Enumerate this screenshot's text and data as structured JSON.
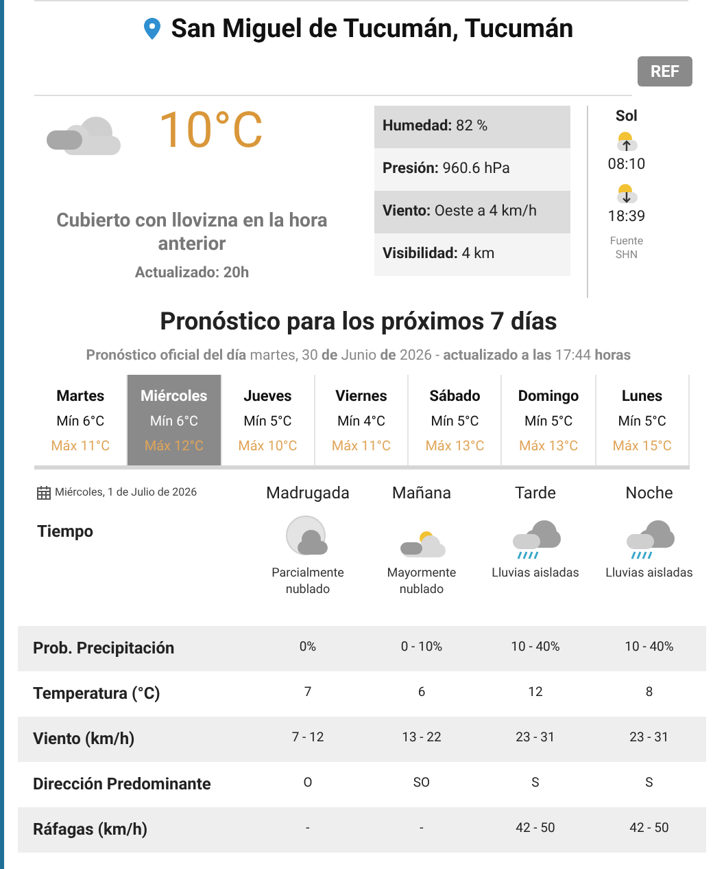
{
  "location": {
    "title": "San Miguel de Tucumán, Tucumán"
  },
  "ref_button": "REF",
  "current": {
    "temperature": "10°C",
    "description": "Cubierto con llovizna en la hora anterior",
    "updated": "Actualizado: 20h",
    "details": [
      {
        "label": "Humedad:",
        "value": "82 %"
      },
      {
        "label": "Presión:",
        "value": "960.6 hPa"
      },
      {
        "label": "Viento:",
        "value": "Oeste a 4 km/h"
      },
      {
        "label": "Visibilidad:",
        "value": "4 km"
      }
    ],
    "sun": {
      "title": "Sol",
      "sunrise": "08:10",
      "sunset": "18:39",
      "source": "Fuente SHN"
    }
  },
  "forecast": {
    "title": "Pronóstico para los próximos 7 días",
    "subtitle": "**Pronóstico oficial del día** martes, 30 **de** Junio **de** 2026 - **actualizado a las** 17:44 **horas**",
    "days": [
      {
        "name": "Martes",
        "min": "Mín 6°C",
        "max": "Máx 11°C",
        "selected": false
      },
      {
        "name": "Miércoles",
        "min": "Mín 6°C",
        "max": "Máx 12°C",
        "selected": true
      },
      {
        "name": "Jueves",
        "min": "Mín 5°C",
        "max": "Máx 10°C",
        "selected": false
      },
      {
        "name": "Viernes",
        "min": "Mín 4°C",
        "max": "Máx 11°C",
        "selected": false
      },
      {
        "name": "Sábado",
        "min": "Mín 5°C",
        "max": "Máx 13°C",
        "selected": false
      },
      {
        "name": "Domingo",
        "min": "Mín 5°C",
        "max": "Máx 13°C",
        "selected": false
      },
      {
        "name": "Lunes",
        "min": "Mín 5°C",
        "max": "Máx 15°C",
        "selected": false
      }
    ]
  },
  "hourly": {
    "date": "Miércoles, 1 de Julio de 2026",
    "weather_label": "Tiempo",
    "periods": [
      {
        "name": "Madrugada",
        "kind": "night_cloud",
        "sky": "Parcialmente nublado"
      },
      {
        "name": "Mañana",
        "kind": "sun_cloud",
        "sky": "Mayormente nublado"
      },
      {
        "name": "Tarde",
        "kind": "rain",
        "sky": "Lluvias aisladas"
      },
      {
        "name": "Noche",
        "kind": "rain",
        "sky": "Lluvias aisladas"
      }
    ],
    "rows": [
      {
        "label": "Prob. Precipitación",
        "values": [
          "0%",
          "0 - 10%",
          "10 - 40%",
          "10 - 40%"
        ]
      },
      {
        "label": "Temperatura (°C)",
        "values": [
          "7",
          "6",
          "12",
          "8"
        ]
      },
      {
        "label": "Viento (km/h)",
        "values": [
          "7 - 12",
          "13 - 22",
          "23 - 31",
          "23 - 31"
        ]
      },
      {
        "label": "Dirección Predominante",
        "values": [
          "O",
          "SO",
          "S",
          "S"
        ]
      },
      {
        "label": "Ráfagas (km/h)",
        "values": [
          "-",
          "-",
          "42 - 50",
          "42 - 50"
        ]
      }
    ]
  }
}
